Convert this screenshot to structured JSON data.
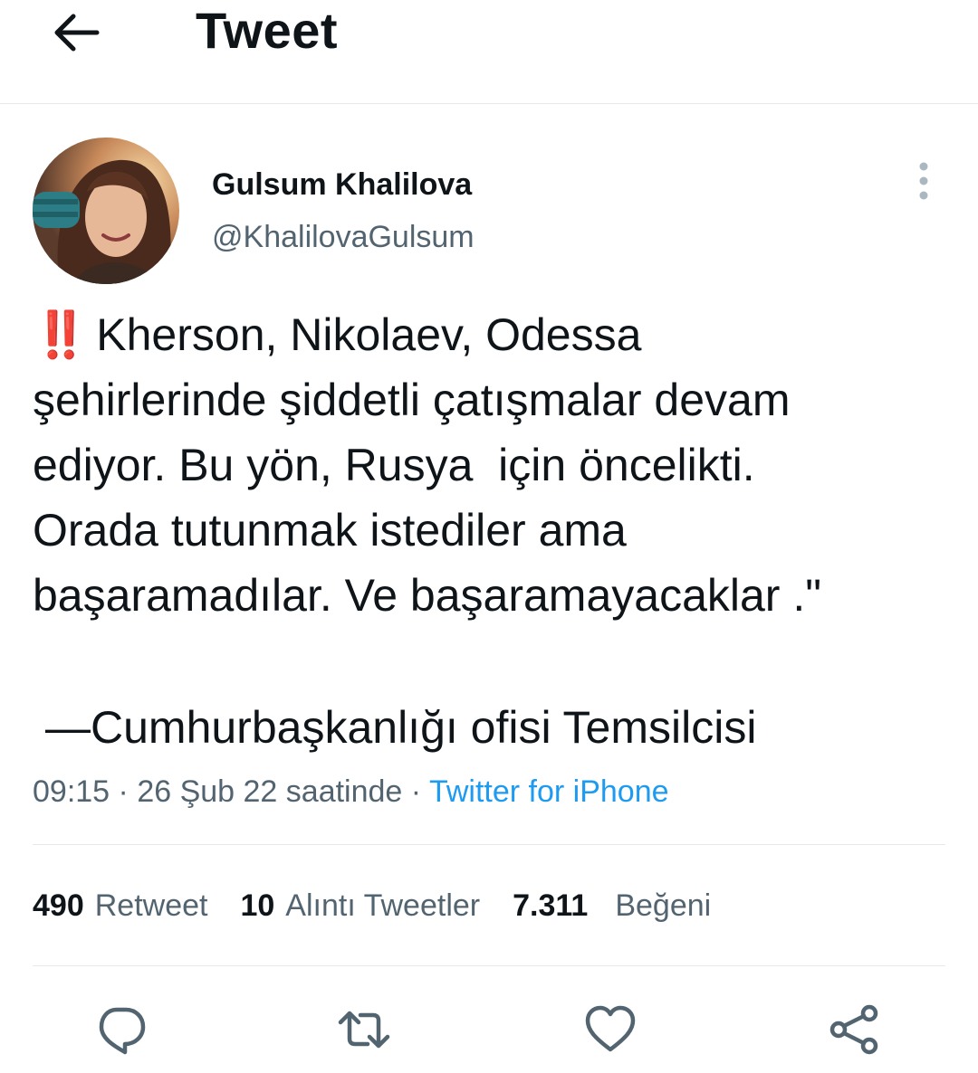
{
  "header": {
    "title": "Tweet",
    "back_icon": "arrow-left-icon"
  },
  "author": {
    "display_name": "Gulsum Khalilova",
    "handle": "@KhalilovaGulsum",
    "avatar_icon": "avatar",
    "more_icon": "more-vertical-icon"
  },
  "tweet": {
    "emoji": "‼️",
    "lines": [
      "Kherson, Nikolaev, Odessa",
      "şehirlerinde şiddetli çatışmalar devam",
      "ediyor. Bu yön, Rusya  için öncelikti.",
      "Orada tutunmak istediler ama",
      "başaramadılar. Ve başaramayacaklar .\""
    ],
    "quote": "—Cumhurbaşkanlığı ofisi Temsilcisi"
  },
  "meta": {
    "time": "09:15",
    "sep1": " · ",
    "date": "26 Şub 22 saatinde",
    "sep2": " · ",
    "source": "Twitter for iPhone"
  },
  "stats": {
    "retweets": {
      "count": "490",
      "label": "Retweet"
    },
    "quotes": {
      "count": "10",
      "label": "Alıntı Tweetler"
    },
    "likes": {
      "count": "7.311",
      "label": "Beğeni"
    }
  },
  "actions": {
    "reply_icon": "reply-icon",
    "retweet_icon": "retweet-icon",
    "like_icon": "heart-icon",
    "share_icon": "share-icon"
  },
  "colors": {
    "text": "#0f1419",
    "secondary": "#536471",
    "link": "#1d9bf0",
    "divider": "#e6e9ea",
    "emoji_red": "#e0112e"
  }
}
